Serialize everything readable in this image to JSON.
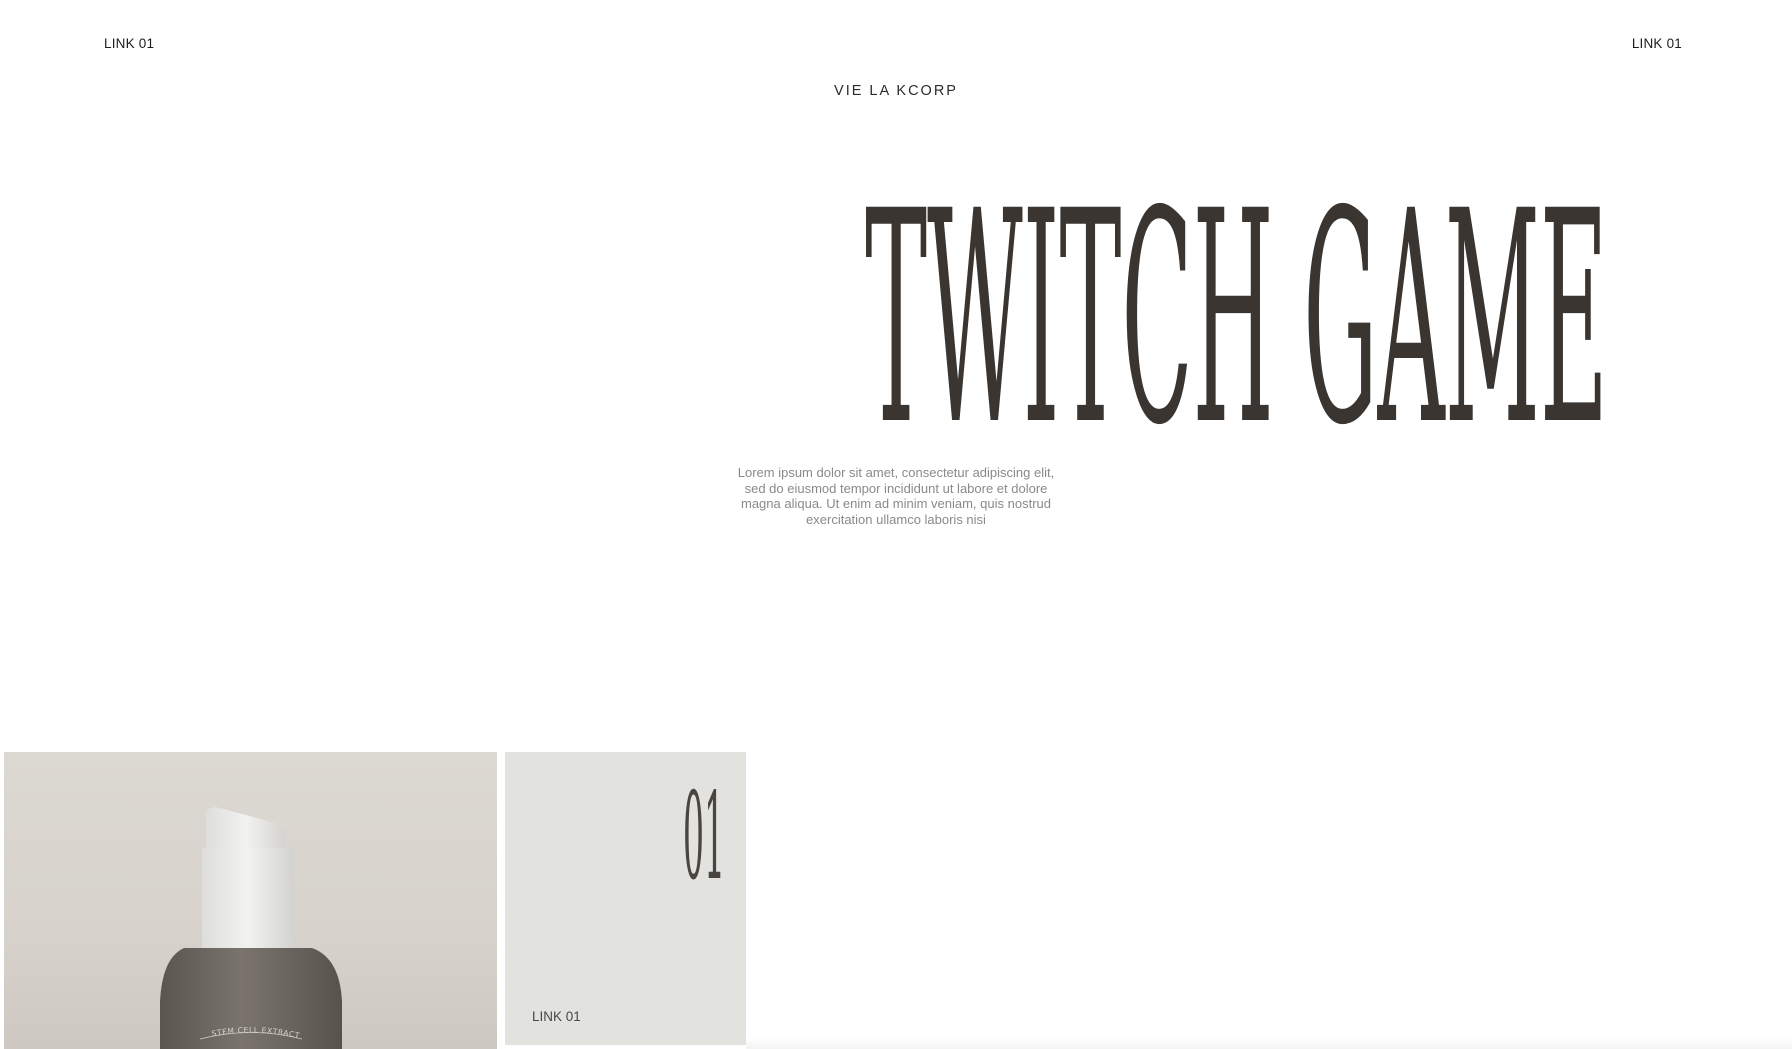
{
  "nav": {
    "left_link": "LINK 01",
    "right_link": "LINK 01"
  },
  "brand": "VIE LA KCORP",
  "hero": {
    "title": "TWITCH GAME",
    "description": "Lorem ipsum dolor sit amet, consectetur adipiscing elit, sed do eiusmod tempor incididunt ut labore et dolore magna aliqua. Ut enim ad minim veniam, quis nostrud exercitation ullamco laboris nisi"
  },
  "products": [
    {
      "image_label": "STEM CELL EXTRACT",
      "index": "01",
      "link": "LINK 01"
    }
  ],
  "colors": {
    "title": "#3a3530",
    "card_bg": "#e2e2de",
    "product_bg": "#d9d5cf",
    "bottle": "#6b6660",
    "pump": "#ececea"
  }
}
